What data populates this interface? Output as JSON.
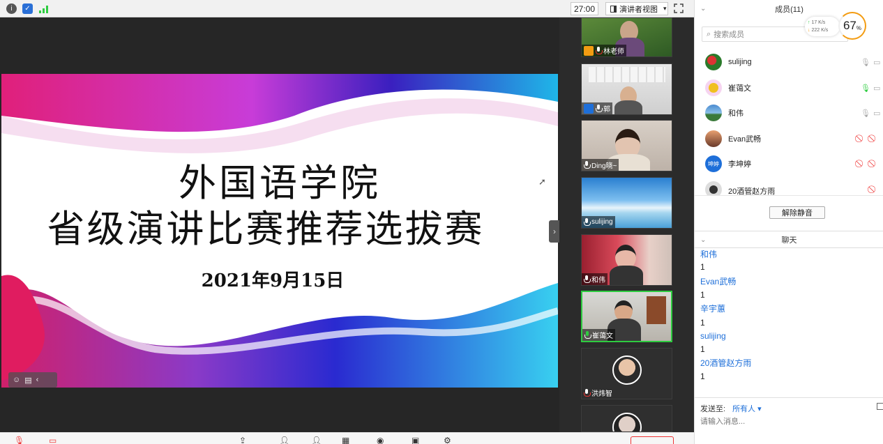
{
  "topbar": {
    "timer": "27:00",
    "view_mode": "演讲者视图",
    "view_arrow": "▾"
  },
  "slide": {
    "title_line1": "外国语学院",
    "title_line2": "省级演讲比赛推荐选拔赛",
    "date": "2021年9月15日"
  },
  "videos": [
    {
      "name": "林老师",
      "mic": "off"
    },
    {
      "name": "郭",
      "mic": "on"
    },
    {
      "name": "Ding晓~",
      "mic": "on"
    },
    {
      "name": "sulijing",
      "mic": "on"
    },
    {
      "name": "和伟",
      "mic": "on"
    },
    {
      "name": "崔蔼文",
      "mic": "active"
    },
    {
      "name": "洪炜智",
      "mic": "off"
    },
    {
      "name": "",
      "mic": "off"
    }
  ],
  "members_panel": {
    "header": "成员(11)",
    "search_placeholder": "搜索成员",
    "net_up": "17  K/s",
    "net_down": "222 K/s",
    "cpu_percent": "67",
    "cpu_unit": "%",
    "members": [
      {
        "name": "sulijing",
        "avatar_text": "",
        "mic": "on",
        "video": "on"
      },
      {
        "name": "崔蔼文",
        "avatar_text": "",
        "mic": "speaking",
        "video": "on"
      },
      {
        "name": "和伟",
        "avatar_text": "",
        "mic": "on",
        "video": "on"
      },
      {
        "name": "Evan武畅",
        "avatar_text": "",
        "mic": "off",
        "video": "off"
      },
      {
        "name": "李坤婷",
        "avatar_text": "坤婷",
        "mic": "off",
        "video": "off"
      },
      {
        "name": "20酒管赵方雨",
        "avatar_text": "",
        "mic": "off",
        "video": ""
      }
    ],
    "unmute_all": "解除静音"
  },
  "chat": {
    "header": "聊天",
    "messages": [
      {
        "sender": "和伟",
        "text": "1"
      },
      {
        "sender": "Evan武畅",
        "text": "1"
      },
      {
        "sender": "辛宇蕙",
        "text": "1"
      },
      {
        "sender": "sulijing",
        "text": "1"
      },
      {
        "sender": "20酒管赵方雨",
        "text": "1"
      }
    ],
    "send_to_label": "发送至:",
    "send_to_target": "所有人 ▾",
    "input_placeholder": "请输入消息..."
  },
  "colors": {
    "accent_blue": "#1e6fd9",
    "active_green": "#2ecc40",
    "danger_red": "#e33333",
    "gauge_orange": "#f39c12"
  }
}
